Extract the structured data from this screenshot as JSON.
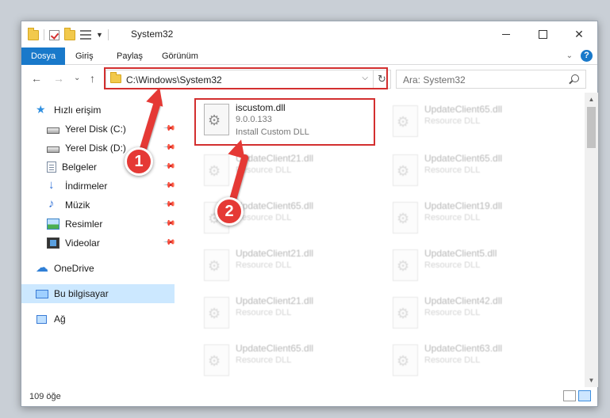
{
  "window": {
    "title": "System32",
    "close_glyph": "✕"
  },
  "ribbon": {
    "tabs": [
      "Dosya",
      "Giriş",
      "Paylaş",
      "Görünüm"
    ],
    "help_glyph": "?"
  },
  "navigation": {
    "back_glyph": "←",
    "forward_glyph": "→",
    "recent_glyph": "⌄",
    "up_glyph": "↑",
    "address": "C:\\Windows\\System32",
    "address_dropdown_glyph": "⌵",
    "refresh_glyph": "↻",
    "search_placeholder": "Ara: System32"
  },
  "sidebar": {
    "quick_access": "Hızlı erişim",
    "items": [
      {
        "label": "Yerel Disk (C:)",
        "icon": "drive-icon"
      },
      {
        "label": "Yerel Disk (D:)",
        "icon": "drive-icon"
      },
      {
        "label": "Belgeler",
        "icon": "documents-icon"
      },
      {
        "label": "İndirmeler",
        "icon": "downloads-icon"
      },
      {
        "label": "Müzik",
        "icon": "music-icon"
      },
      {
        "label": "Resimler",
        "icon": "pictures-icon"
      },
      {
        "label": "Videolar",
        "icon": "videos-icon"
      }
    ],
    "onedrive": "OneDrive",
    "this_pc": "Bu bilgisayar",
    "network": "Ağ"
  },
  "files": [
    {
      "name": "iscustom.dll",
      "version": "9.0.0.133",
      "desc": "Install Custom DLL",
      "highlight": true
    },
    {
      "name": "UpdateClient65.dll",
      "desc": "Resource DLL"
    },
    {
      "name": "UpdateClient21.dll",
      "desc": "Resource DLL"
    },
    {
      "name": "UpdateClient65.dll",
      "desc": "Resource DLL"
    },
    {
      "name": "UpdateClient65.dll",
      "desc": "Resource DLL"
    },
    {
      "name": "UpdateClient19.dll",
      "desc": "Resource DLL"
    },
    {
      "name": "UpdateClient21.dll",
      "desc": "Resource DLL"
    },
    {
      "name": "UpdateClient5.dll",
      "desc": "Resource DLL"
    },
    {
      "name": "UpdateClient21.dll",
      "desc": "Resource DLL"
    },
    {
      "name": "UpdateClient42.dll",
      "desc": "Resource DLL"
    },
    {
      "name": "UpdateClient65.dll",
      "desc": "Resource DLL"
    },
    {
      "name": "UpdateClient63.dll",
      "desc": "Resource DLL"
    }
  ],
  "status": {
    "item_count": "109 öğe"
  },
  "callouts": [
    "1",
    "2"
  ],
  "colors": {
    "accent": "#1979ca",
    "annotation_red": "#d32f2f",
    "selection": "#cce8ff"
  }
}
